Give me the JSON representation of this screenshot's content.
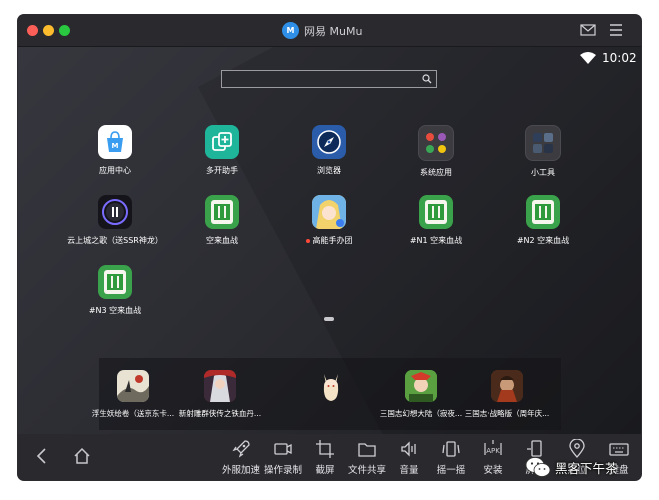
{
  "window": {
    "title": "网易 MuMu",
    "logo_text": "M"
  },
  "statusbar": {
    "time": "10:02"
  },
  "search": {
    "placeholder": ""
  },
  "apps": [
    {
      "label": "应用中心",
      "icon": "app-center-icon",
      "color": "#ffffff"
    },
    {
      "label": "多开助手",
      "icon": "multi-open-icon",
      "color": "#1fb59b"
    },
    {
      "label": "浏览器",
      "icon": "compass-icon",
      "color": "#2a5caa"
    },
    {
      "label": "系统应用",
      "icon": "folder-icon",
      "color": "#3b3b40"
    },
    {
      "label": "小工具",
      "icon": "tools-folder-icon",
      "color": "#3b3b40"
    },
    {
      "label": "云上城之歌（送SSR神龙）",
      "icon": "game-cloud-city-icon",
      "color": "#14141a"
    },
    {
      "label": "空来血战",
      "icon": "mahjong-icon",
      "color": "#3aa24a"
    },
    {
      "label": "高能手办团",
      "icon": "anime-girl-icon",
      "color": "#e9c36a",
      "badge": true
    },
    {
      "label": "#N1 空来血战",
      "icon": "mahjong-icon",
      "color": "#3aa24a"
    },
    {
      "label": "#N2 空来血战",
      "icon": "mahjong-icon",
      "color": "#3aa24a"
    },
    {
      "label": "#N3 空来血战",
      "icon": "mahjong-icon",
      "color": "#3aa24a"
    }
  ],
  "dock": [
    {
      "label": "浮生妖绘卷（送京东卡...",
      "icon": "ink-painting-icon",
      "color": "#e8e2d2"
    },
    {
      "label": "新射雕群侠传之铁血丹...",
      "icon": "wuxia-hero-icon",
      "color": "#8b3a2a"
    },
    {
      "label": "",
      "icon": "anime-fox-girl-icon",
      "color": "#f4e3c7"
    },
    {
      "label": "三国志幻想大陆（寂夜...",
      "icon": "three-kingdoms-fantasy-icon",
      "color": "#4f8f3a"
    },
    {
      "label": "三国志·战略版（周年庆...",
      "icon": "three-kingdoms-strategy-icon",
      "color": "#6b3a22"
    }
  ],
  "toolbar": {
    "back": "back-icon",
    "home": "home-icon",
    "tools": [
      {
        "label": "外服加速",
        "icon": "rocket-icon"
      },
      {
        "label": "操作录制",
        "icon": "record-icon"
      },
      {
        "label": "截屏",
        "icon": "crop-icon"
      },
      {
        "label": "文件共享",
        "icon": "folder-share-icon"
      },
      {
        "label": "音量",
        "icon": "volume-icon"
      },
      {
        "label": "摇一摇",
        "icon": "shake-icon"
      },
      {
        "label": "安装",
        "icon": "apk-install-icon",
        "apk_text": "APK"
      },
      {
        "label": "屏幕",
        "icon": "screen-rotate-icon"
      },
      {
        "label": "定位",
        "icon": "location-icon"
      },
      {
        "label": "键盘",
        "icon": "keyboard-icon"
      }
    ]
  },
  "watermark": {
    "text": "黑客下午茶"
  }
}
